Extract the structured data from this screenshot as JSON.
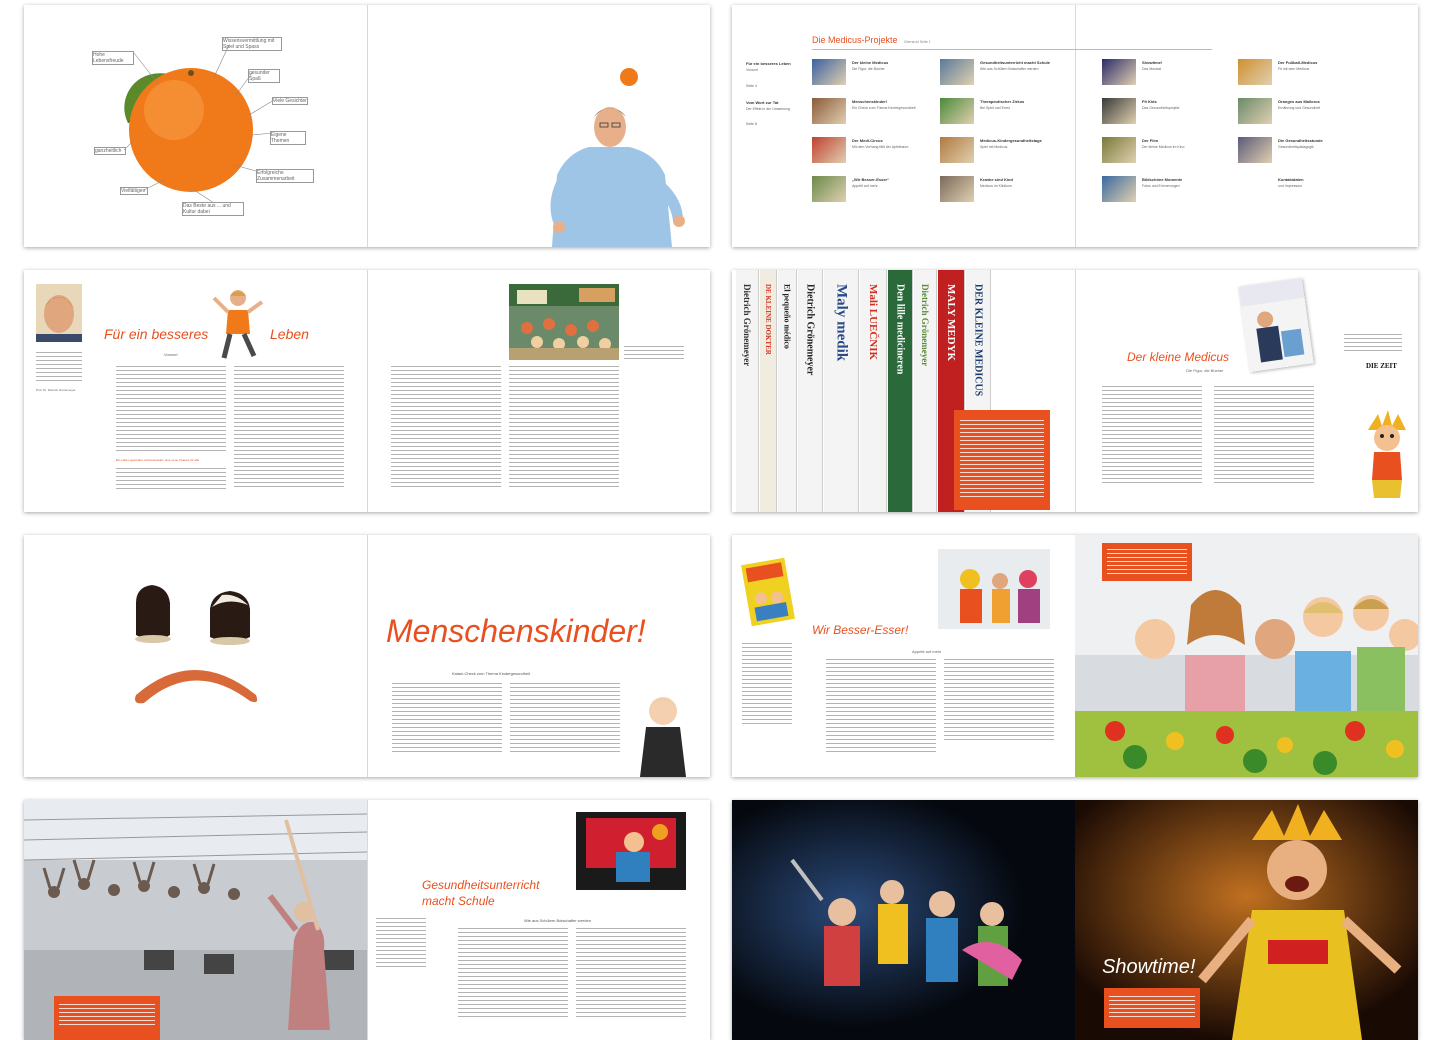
{
  "spread1": {
    "labels": [
      "Hohe Lebensfreude",
      "Wissensvermittlung mit Spiel und Spass",
      "gesunder Spaß",
      "Viele Gesichter",
      "Eigene Themen",
      "ganzheitlich",
      "Erfolgreiche Zusammenarbeit",
      "Vielfältiges",
      "Das Beste aus ... und Kultur dabei"
    ]
  },
  "spread2": {
    "title": "Die Medicus-Projekte",
    "subtitle": "Übersicht Seite 1",
    "left_items": [
      {
        "title": "Für ein besseres Leben",
        "sub": "Vorwort",
        "page": "Seite 4"
      },
      {
        "title": "Vom Wort zur Tat",
        "sub": "Der Effekt in der Umsetzung",
        "page": "Seite 8"
      }
    ],
    "projects": [
      {
        "title": "Der kleine Medicus",
        "sub": "Die Figur, die Bücher"
      },
      {
        "title": "Menschenskinder!",
        "sub": "Ein Check zum Thema Kindergesundheit"
      },
      {
        "title": "Der Medi-Circus",
        "sub": "Mit dem Vorhang fällt der Apfelbaum"
      },
      {
        "title": "„Wir Besser-Esser“",
        "sub": "Appetit auf mehr"
      },
      {
        "title": "Gesundheitsunterricht macht Schule",
        "sub": "Wie aus Schülern Botschafter werden"
      },
      {
        "title": "Therapeutischer Zirkus",
        "sub": "Bei Spiel und Ernst"
      },
      {
        "title": "Medicus-Kindergesundheitstage",
        "sub": "Spiel mit Medicus"
      },
      {
        "title": "Kranke sind Kind",
        "sub": "Medicus im Klinikum"
      },
      {
        "title": "Showtime!",
        "sub": "Das Musical"
      },
      {
        "title": "Fit Kids",
        "sub": "Das Gesundheitsprojekt"
      },
      {
        "title": "Der Film",
        "sub": "Der kleine Medicus im Kino"
      },
      {
        "title": "Bildschöne Momente",
        "sub": "Fotos und Erinnerungen"
      },
      {
        "title": "Der Fußball-Medicus",
        "sub": "Fit mit dem Medicus"
      },
      {
        "title": "Oranges aus Mallorca",
        "sub": "Ernährung und Gesundheit"
      },
      {
        "title": "Die Gesundheitsstunde",
        "sub": "Gesundheitspädagogik"
      },
      {
        "title": "Kontaktdaten",
        "sub": "und Impressum"
      }
    ]
  },
  "spread3": {
    "title_left": "Für ein besseres",
    "title_right": "Leben",
    "subtitle": "Vorwort",
    "orange_quote": "Ein Leben gesünder und bewusster: eine neue Chance für alle",
    "signature": "Prof. Dr. Dietrich Grönemeyer"
  },
  "spread4": {
    "books": [
      "Dietrich Grönemeyer",
      "DE KLEINE DOKTER",
      "El pequeño médico",
      "Dietrich Grönemeyer",
      "Maly medik",
      "Mali LUEČNIK",
      "Den lille medicineren",
      "Dietrich Grönemeyer",
      "MALY MEDYK",
      "DER KLEINE MEDICUS"
    ],
    "title": "Der kleine Medicus",
    "subtitle": "Die Figur, die Bücher",
    "logo": "DIE ZEIT"
  },
  "spread5": {
    "title": "Menschenskinder!",
    "subtitle": "Kalani-Check zum Thema Kindergesundheit"
  },
  "spread6": {
    "title": "Wir Besser-Esser!",
    "subtitle": "Appetit auf mehr"
  },
  "spread7": {
    "title_line1": "Gesundheitsunterricht",
    "title_line2": "macht Schule",
    "subtitle": "Wie aus Schülern Botschafter werden"
  },
  "spread8": {
    "title": "Showtime!"
  },
  "colors": {
    "accent": "#e8501f"
  }
}
